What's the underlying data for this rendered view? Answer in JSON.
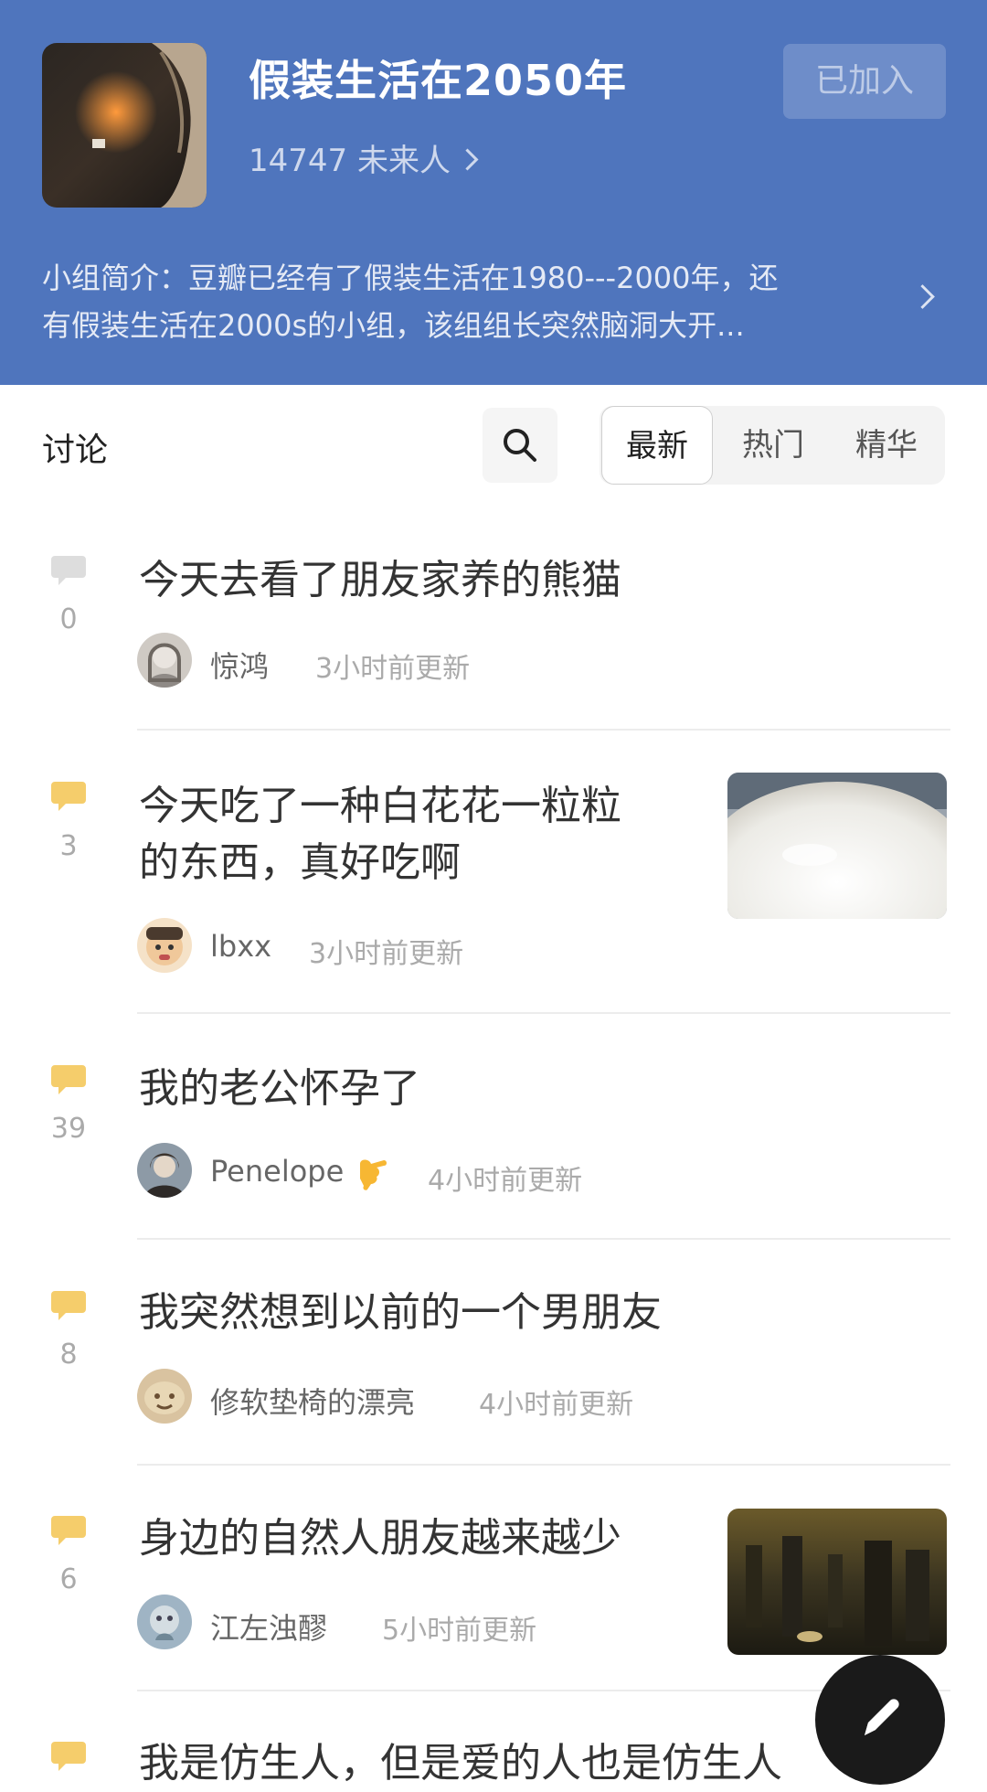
{
  "group": {
    "title": "假装生活在2050年",
    "members": "14747 未来人",
    "join_label": "已加入",
    "intro_line1": "小组简介：豆瓣已经有了假装生活在1980---2000年，还",
    "intro_line2": "有假装生活在2000s的小组，该组组长突然脑洞大开..."
  },
  "toolbar": {
    "discuss_label": "讨论",
    "sort_tabs": [
      "最新",
      "热门",
      "精华"
    ]
  },
  "topics": [
    {
      "count": "0",
      "title1": "今天去看了朋友家养的熊猫",
      "title2": "",
      "author": "惊鸿",
      "time": "3小时前更新"
    },
    {
      "count": "3",
      "title1": "今天吃了一种白花花一粒粒",
      "title2": "的东西，真好吃啊",
      "author": "lbxx",
      "time": "3小时前更新"
    },
    {
      "count": "39",
      "title1": "我的老公怀孕了",
      "title2": "",
      "author": "Penelope",
      "time": "4小时前更新"
    },
    {
      "count": "8",
      "title1": "我突然想到以前的一个男朋友",
      "title2": "",
      "author": "修软垫椅的漂亮",
      "time": "4小时前更新"
    },
    {
      "count": "6",
      "title1": "身边的自然人朋友越来越少",
      "title2": "",
      "author": "江左浊醪",
      "time": "5小时前更新"
    },
    {
      "count": "",
      "title1": "我是仿生人，但是爱的人也是仿生人",
      "title2": "",
      "author": "",
      "time": ""
    }
  ],
  "colors": {
    "header_bg": "#4f75bd",
    "comment_active": "#f5cd6b",
    "comment_inactive": "#dddddd"
  }
}
